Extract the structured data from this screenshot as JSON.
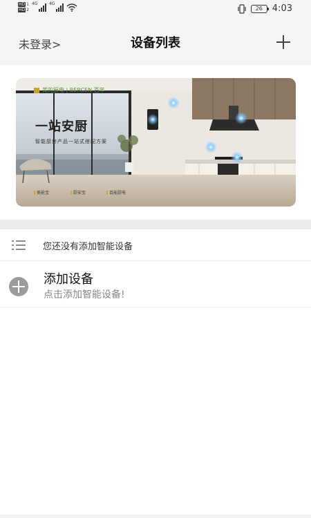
{
  "status_bar": {
    "sim1_label": "HD",
    "sim1_num": "1",
    "sim2_label": "HD",
    "sim2_num": "2",
    "network1": "4G",
    "network2": "4G",
    "battery": "26",
    "time": "4:03"
  },
  "header": {
    "login_label": "未登录>",
    "title": "设备列表"
  },
  "banner": {
    "brand": "美的厨电 | BERCEN 百年",
    "title": "一站安厨",
    "subtitle": "智能厨房产品一站式搭配方案",
    "features": [
      "美能宝",
      "厨安宝",
      "百能厨电"
    ]
  },
  "empty_state": {
    "text": "您还没有添加智能设备"
  },
  "add_device": {
    "title": "添加设备",
    "subtitle": "点击添加智能设备!"
  }
}
